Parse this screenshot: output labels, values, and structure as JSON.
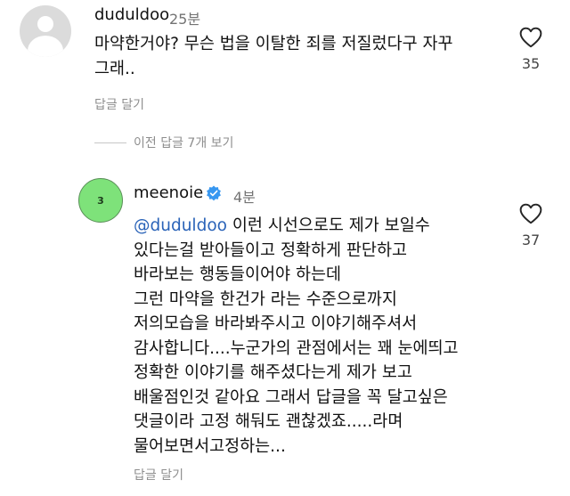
{
  "comments": [
    {
      "username": "duduldoo",
      "time": "25분",
      "text": "마약한거야? 무슨 법을 이탈한 죄를 저질렀다구 자꾸\n그래..",
      "reply_label": "답글 달기",
      "likes": "35",
      "like_icon": "heart-outline-icon"
    },
    {
      "username": "meenoie",
      "avatar_label": "3",
      "verified": true,
      "time": "4분",
      "mention": "@duduldoo",
      "text": " 이런 시선으로도 제가 보일수\n있다는걸 받아들이고 정확하게 판단하고\n바라보는 행동들이어야 하는데\n그런 마약을 한건가 라는 수준으로까지\n저의모습을 바라봐주시고 이야기해주셔서\n감사합니다....누군가의 관점에서는 꽤 눈에띄고\n정확한 이야기를 해주셨다는게 제가 보고\n배울점인것 같아요 그래서 답글을 꼭 달고싶은\n댓글이라 고정 해둬도 괜찮겠죠.....라며\n물어보면서고정하는...",
      "reply_label": "답글 달기",
      "likes": "37",
      "like_icon": "heart-outline-icon"
    }
  ],
  "view_replies": {
    "label": "이전 답글 7개 보기"
  },
  "colors": {
    "mention": "#2a63b8",
    "verified_badge": "#3797f0",
    "secondary_text": "#8e8e8e",
    "avatar_green": "#7ee27a"
  }
}
